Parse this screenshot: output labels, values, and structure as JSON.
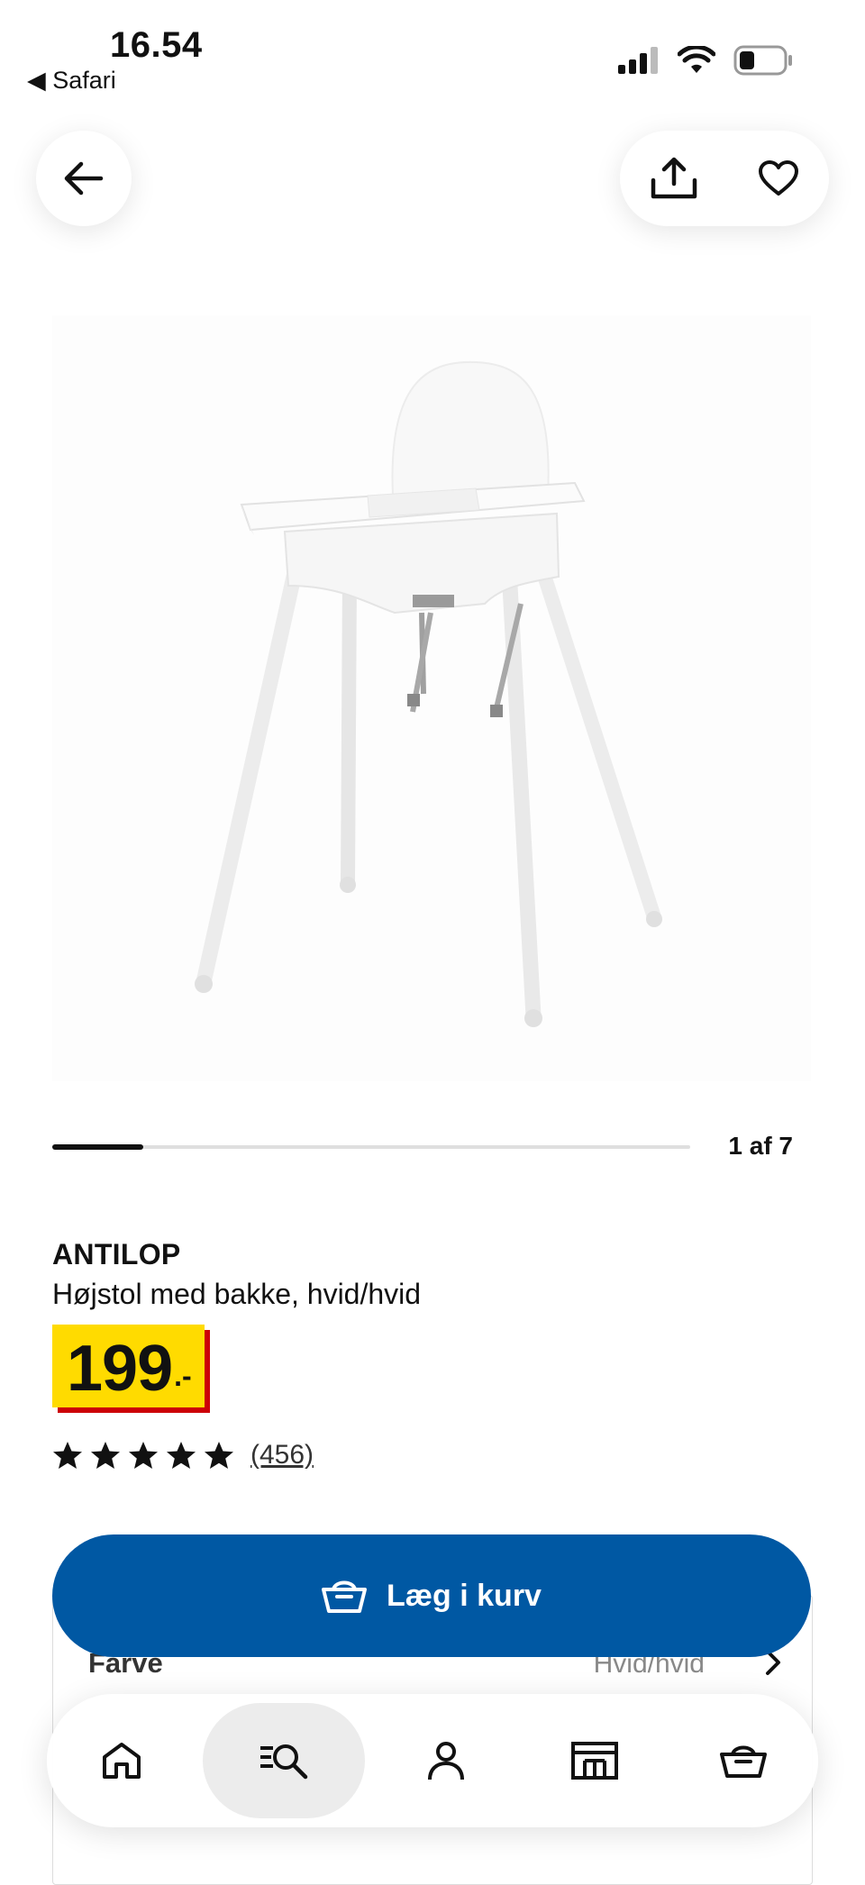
{
  "status_bar": {
    "time": "16.54",
    "back_app": "◀ Safari"
  },
  "header": {
    "back_icon": "arrow-left-icon",
    "share_icon": "share-icon",
    "favorite_icon": "heart-icon"
  },
  "gallery": {
    "image": "high-chair-product-photo",
    "pager_text": "1 af 7",
    "current": 1,
    "total": 7
  },
  "product": {
    "brand": "ANTILOP",
    "description": "Højstol med bakke, hvid/hvid",
    "price_integer": "199",
    "price_decimal": ".-",
    "rating_stars": 5,
    "review_count": "(456)"
  },
  "cart_button": {
    "label": "Læg i kurv",
    "icon": "basket-icon"
  },
  "color_option": {
    "label": "Farve",
    "value": "Hvid/hvid"
  },
  "bottom_nav": [
    {
      "icon": "home-icon"
    },
    {
      "icon": "search-list-icon",
      "active": true
    },
    {
      "icon": "profile-icon"
    },
    {
      "icon": "store-icon"
    },
    {
      "icon": "basket-icon"
    }
  ],
  "colors": {
    "ikea_blue": "#0058a3",
    "price_yellow": "#ffdb00",
    "price_red": "#cc0008"
  }
}
